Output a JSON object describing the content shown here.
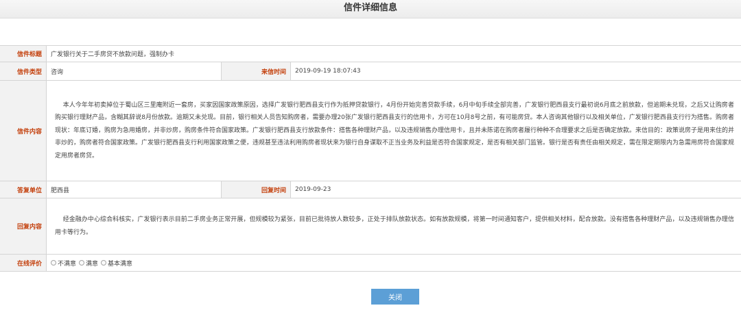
{
  "header": {
    "title": "信件详细信息"
  },
  "letter": {
    "title_label": "信件标题",
    "title": "广发银行关于二手房贷不放款问题，强制办卡",
    "type_label": "信件类型",
    "type": "咨询",
    "time_label": "来信时间",
    "time": "2019-09-19 18:07:43",
    "content_label": "信件内容",
    "content": "本人今年年初卖掉位于蜀山区三里庵附近一套房，买家因国家政策原因，选择广发银行肥西县支行作为抵押贷款银行，4月份开始完善贷款手续，6月中旬手续全部完善，广发银行肥西县支行最初说6月底之前放款，但逾期未兑现，之后又让购房者购买银行理财产品，含糊其辞说8月份放款。逾期又未兑现。目前，银行相关人员告知购房者，需要办理20张广发银行肥西县支行的信用卡，方可在10月8号之前，有可能房贷。本人咨询其他银行以及相关单位，广发银行肥西县支行行为搭售。购房者现状：年底订婚，购房为急用婚房，并非炒房，购房条件符合国家政策。广发银行肥西县支行放款条件：搭售各种理财产品，以及违规销售办理信用卡，且并未陈诺在购房者履行种种不合理要求之后是否确定放款。来信目的：政策说房子是用来住的并非炒的，购房者符合国家政策。广发银行肥西县支行利用国家政策之便，违规甚至违法利用购房者现状来为银行自身谋取不正当业务及利益是否符合国家规定，是否有相关部门监管。银行是否有责任由相关规定，需在限定期限内为急需用房符合国家规定用房者房贷。"
  },
  "reply": {
    "unit_label": "答复单位",
    "unit": "肥西县",
    "time_label": "回复时间",
    "time": "2019-09-23",
    "content_label": "回复内容",
    "content": "经金融办中心综合科核实，广发银行表示目前二手房业务正常开展，但规模较为紧张，目前已批待放人数较多，正处于排队放款状态。如有放款规模，将第一时间通知客户，提供相关材料，配合放款。没有搭售各种理财产品，以及违规销售办理信用卡等行为。"
  },
  "evaluation": {
    "label": "在线评价",
    "options": [
      "不满意",
      "满意",
      "基本满意"
    ]
  },
  "actions": {
    "close_label": "关闭"
  }
}
